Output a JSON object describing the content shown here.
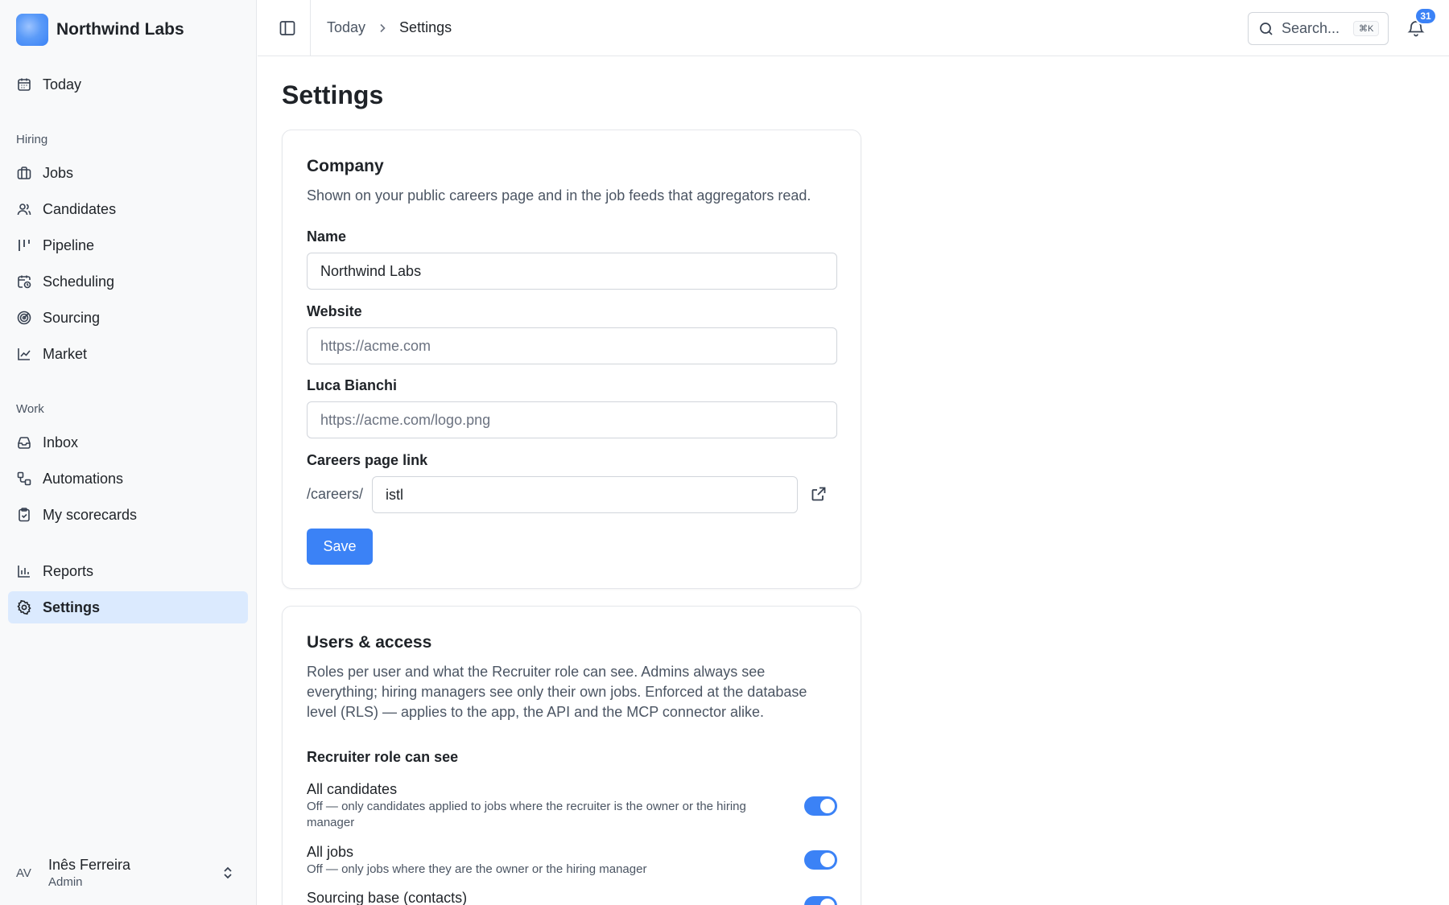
{
  "brand": {
    "name": "Northwind Labs"
  },
  "nav": {
    "today": "Today",
    "hiring_section": "Hiring",
    "jobs": "Jobs",
    "candidates": "Candidates",
    "pipeline": "Pipeline",
    "scheduling": "Scheduling",
    "sourcing": "Sourcing",
    "market": "Market",
    "work_section": "Work",
    "inbox": "Inbox",
    "automations": "Automations",
    "my_scorecards": "My scorecards",
    "reports": "Reports",
    "settings": "Settings"
  },
  "user": {
    "initials": "AV",
    "name": "Inês Ferreira",
    "role": "Admin"
  },
  "topbar": {
    "breadcrumb_parent": "Today",
    "breadcrumb_current": "Settings",
    "search_placeholder": "Search...",
    "search_shortcut": "⌘K",
    "notification_count": "31"
  },
  "page": {
    "title": "Settings"
  },
  "company": {
    "title": "Company",
    "description": "Shown on your public careers page and in the job feeds that aggregators read.",
    "name_label": "Name",
    "name_value": "Northwind Labs",
    "website_label": "Website",
    "website_placeholder": "https://acme.com",
    "logo_label": "Luca Bianchi",
    "logo_placeholder": "https://acme.com/logo.png",
    "careers_label": "Careers page link",
    "careers_prefix": "/careers/",
    "careers_value": "istl",
    "save_label": "Save"
  },
  "users_access": {
    "title": "Users & access",
    "description": "Roles per user and what the Recruiter role can see. Admins always see everything; hiring managers see only their own jobs. Enforced at the database level (RLS) — applies to the app, the API and the MCP connector alike.",
    "recruiter_heading": "Recruiter role can see",
    "permissions": [
      {
        "title": "All candidates",
        "description": "Off — only candidates applied to jobs where the recruiter is the owner or the hiring manager",
        "enabled": true
      },
      {
        "title": "All jobs",
        "description": "Off — only jobs where they are the owner or the hiring manager",
        "enabled": true
      },
      {
        "title": "Sourcing base (contacts)",
        "description": "",
        "enabled": true
      }
    ]
  },
  "colors": {
    "accent": "#3b82f6",
    "active_nav_bg": "#dbeafe",
    "sidebar_bg": "#f8f9fa"
  }
}
